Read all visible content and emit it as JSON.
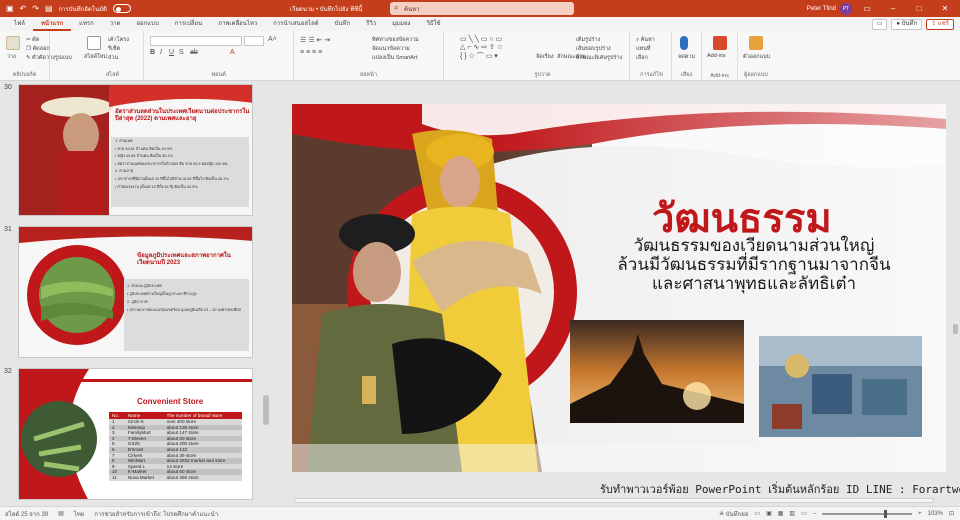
{
  "titlebar": {
    "autosave_label": "การบันทึกอัตโนมัติ",
    "doc_title": "เวียดนาม • บันทึกไปยัง พีซีนี้",
    "search_placeholder": "ค้นหา",
    "user_name": "Peter Tfind",
    "user_initials": "PT"
  },
  "tabs": [
    "ไฟล์",
    "หน้าแรก",
    "แทรก",
    "วาด",
    "ออกแบบ",
    "การเปลี่ยน",
    "ภาพเคลื่อนไหว",
    "การนำเสนอสไลด์",
    "บันทึก",
    "รีวิว",
    "มุมมอง",
    "วิธีใช้"
  ],
  "active_tab": "หน้าแรก",
  "tab_actions": {
    "comment": "",
    "record": "บันทึก",
    "share": "แชร์"
  },
  "ribbon": {
    "groups": [
      "คลิปบอร์ด",
      "สไลด์",
      "ฟอนต์",
      "ย่อหน้า",
      "รูปวาด",
      "การแก้ไข",
      "เสียง",
      "Add-ins",
      "ผู้ออกแบบ"
    ],
    "clipboard": {
      "paste": "วาง",
      "cut": "ตัด",
      "copy": "คัดลอก",
      "format_painter": "ตัวคัดวางรูปแบบ"
    },
    "slides": {
      "new_slide": "สไลด์ใหม่",
      "layout": "เค้าโครง",
      "reset": "รีเซ็ต",
      "section": "ส่วน"
    },
    "paragraph": {
      "text_direction": "ทิศทางของข้อความ",
      "align_text": "จัดแนวข้อความ",
      "smartart": "แปลงเป็น SmartArt"
    },
    "drawing": {
      "arrange": "จัดเรียง",
      "quick_styles": "ลักษณะด่วน",
      "fill": "เติมรูปร่าง",
      "outline": "เส้นขอบรูปร่าง",
      "effects": "ลักษณะพิเศษรูปร่าง"
    },
    "editing": {
      "find": "ค้นหา",
      "replace": "แทนที่",
      "select": "เลือก"
    },
    "voice": {
      "dictate": "จดตาม"
    },
    "addins": {
      "label": "Add-ins"
    },
    "designer": {
      "label": "ตัวออกแบบ"
    }
  },
  "thumbnails": [
    {
      "number": "30",
      "title": "อัตราส่วนลดส่วนในประเทศเวียดนามต่อประชากรในปีล่าสุด (2022) ตามเพศและอายุ",
      "bullets": [
        "1. ตามเพศ",
        "• ชาย 49.61 ล้านคน คิดเป็น 49.9%",
        "• หญิง 49.85 ล้านคน คิดเป็น 50.1%",
        "• อัตราส่วนเพศของประชากรในปี 2565 คือ ชาย 99.5 ต่อหญิง 100 คน",
        "2. ตามอายุ",
        "• ประชากรที่มีอายุตั้งแต่ 15 ปีขึ้นไปมีจำนวน 65 ปีขึ้นไป คิดเป็น 46.1%",
        "• กำลังแรงงาน (ตั้งแต่ 15 ปีถึง 64 ปี) คิดเป็น 53.9%"
      ]
    },
    {
      "number": "31",
      "title": "ข้อมูลภูมิประเทศและสภาพอากาศในเวียดนามปี 2023",
      "bullets": [
        "1. ลักษณะภูมิประเทศ",
        "• ภูมิประเทศส่วนใหญ่เป็นภูเขาและที่ราบสูง",
        "2. ภูมิอากาศ",
        "• สภาพอากาศแบบมรสุมเขตร้อน อุณหภูมิเฉลี่ย 23 – 39 องศาเซลเซียส"
      ]
    },
    {
      "number": "32",
      "title": "Convenient Store",
      "table_headers": [
        "No.",
        "Name",
        "The number of brand/ store"
      ],
      "rows": [
        [
          "1",
          "Circle K",
          "over 400 store"
        ],
        [
          "2",
          "Ministop",
          "about 135 store"
        ],
        [
          "3",
          "FamilyMart",
          "about 147 store"
        ],
        [
          "4",
          "7-Eleven",
          "about 60 store"
        ],
        [
          "5",
          "GS25",
          "about 200 store"
        ],
        [
          "6",
          "B'smart",
          "about 122"
        ],
        [
          "7",
          "Cirkers",
          "about 39 store"
        ],
        [
          "8",
          "WinMart",
          "about 2832 market and store"
        ],
        [
          "9",
          "Speed L",
          "14 store"
        ],
        [
          "10",
          "K-Market",
          "about 60 store"
        ],
        [
          "11",
          "Nova Market",
          "about 459 store"
        ]
      ]
    }
  ],
  "slide": {
    "title": "วัฒนธรรม",
    "subtitle_lines": [
      "วัฒนธรรมของเวียดนามส่วนใหญ่",
      "ล้วนมีวัฒนธรรมที่มีรากฐานมาจากจีน",
      "และศาสนาพุทธและลัทธิเต๋า"
    ]
  },
  "watermark": "รับทำพาวเวอร์พ้อย PowerPoint เริ่มต้นหลักร้อย ID LINE : Forartwork",
  "status": {
    "slide_counter": "สไลด์ 25 จาก 39",
    "language": "ไทย",
    "accessibility": "การช่วยสำหรับการเข้าถึง: โปรดศึกษาคำแนะนำ",
    "notes": "บันทึกย่อ",
    "zoom": "103%"
  },
  "colors": {
    "brand": "#c43e1c",
    "slide_red": "#c0171b"
  }
}
